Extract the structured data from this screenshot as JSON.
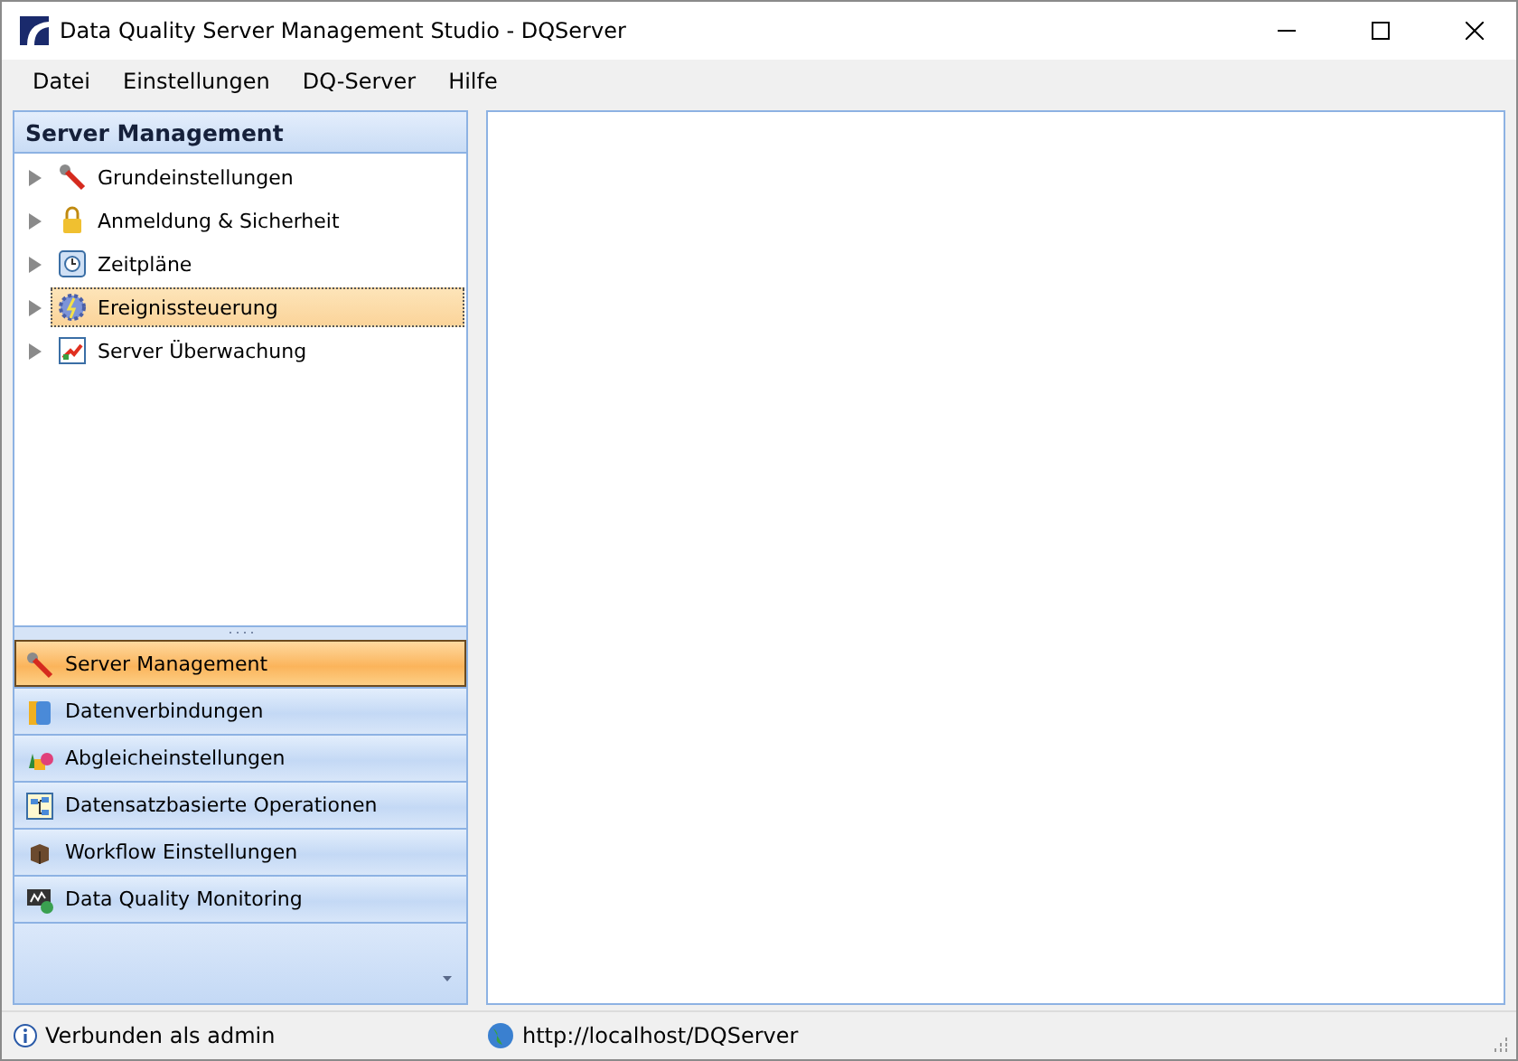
{
  "window": {
    "title": "Data Quality Server Management Studio - DQServer"
  },
  "menu": [
    "Datei",
    "Einstellungen",
    "DQ-Server",
    "Hilfe"
  ],
  "tree": {
    "title": "Server Management",
    "items": [
      {
        "label": "Grundeinstellungen",
        "kind": "wrench",
        "selected": false,
        "expanded": false
      },
      {
        "label": "Anmeldung & Sicherheit",
        "kind": "lock",
        "selected": false,
        "expanded": false
      },
      {
        "label": "Zeitpläne",
        "kind": "clock",
        "selected": false,
        "expanded": false
      },
      {
        "label": "Ereignissteuerung",
        "kind": "gear",
        "selected": true,
        "expanded": false
      },
      {
        "label": "Server Überwachung",
        "kind": "chart",
        "selected": false,
        "expanded": false
      }
    ]
  },
  "nav": [
    {
      "label": "Server Management",
      "kind": "wrench",
      "selected": true
    },
    {
      "label": "Datenverbindungen",
      "kind": "database",
      "selected": false
    },
    {
      "label": "Abgleicheinstellungen",
      "kind": "shapes",
      "selected": false
    },
    {
      "label": "Datensatzbasierte Operationen",
      "kind": "diagram",
      "selected": false
    },
    {
      "label": "Workflow Einstellungen",
      "kind": "box",
      "selected": false
    },
    {
      "label": "Data Quality Monitoring",
      "kind": "meter",
      "selected": false
    }
  ],
  "status_bar": {
    "user": "Verbunden als admin",
    "url": "http://localhost/DQServer"
  }
}
